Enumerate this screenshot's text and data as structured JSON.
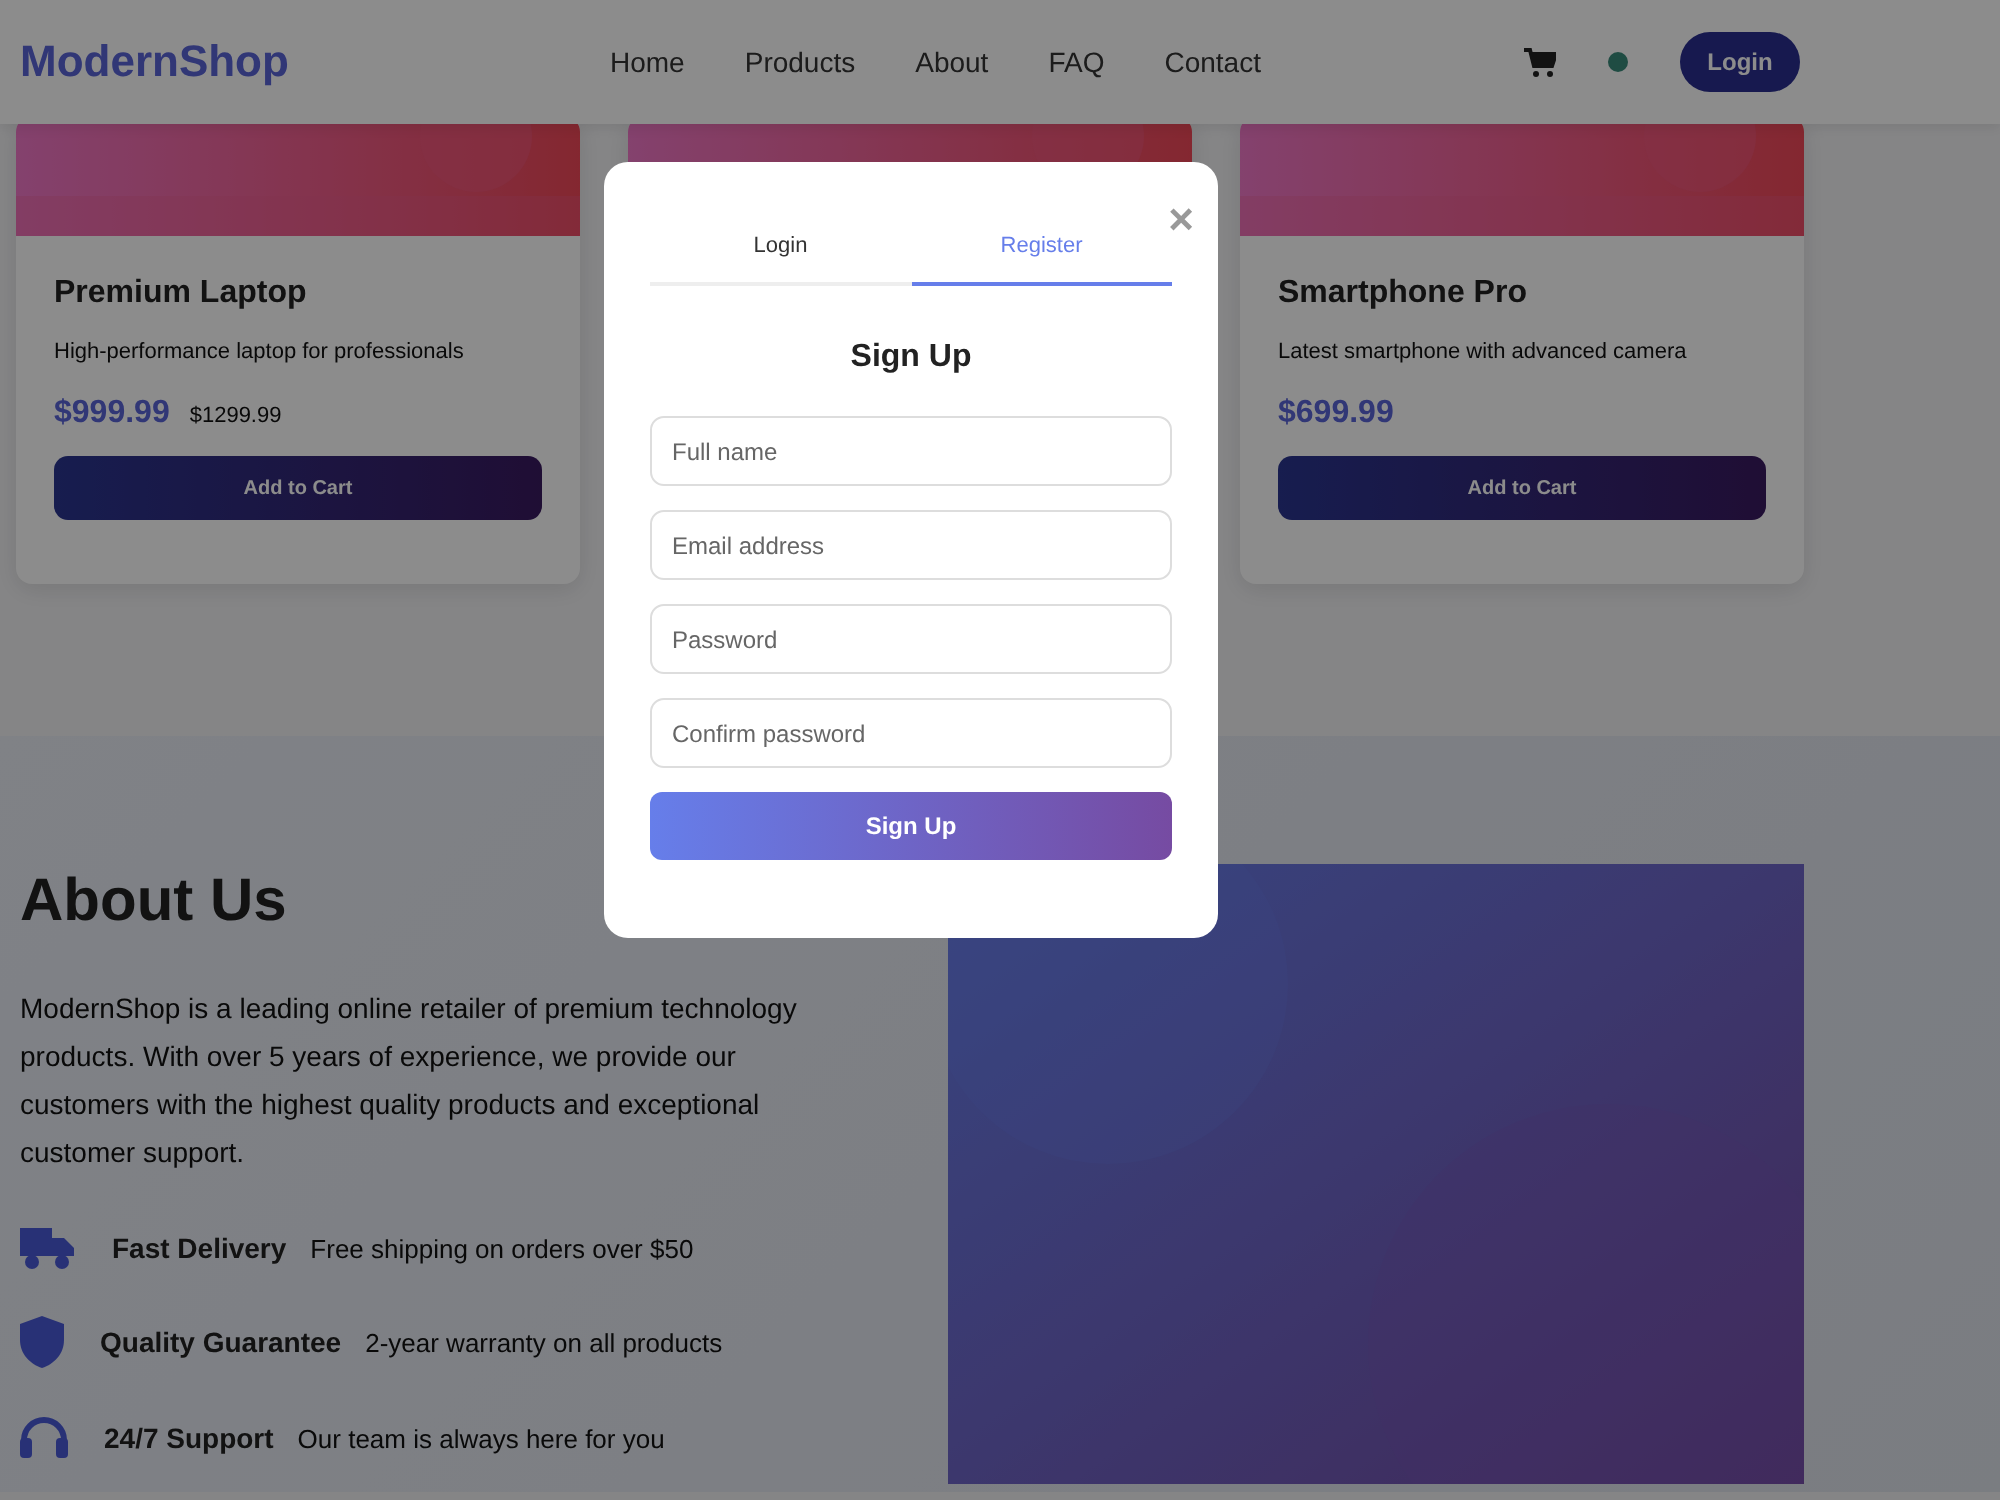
{
  "header": {
    "logo": "ModernShop",
    "nav": [
      "Home",
      "Products",
      "About",
      "FAQ",
      "Contact"
    ],
    "login_button": "Login"
  },
  "products": [
    {
      "kind": "full",
      "title": "Premium Laptop",
      "description": "High-performance laptop for professionals",
      "price": "$999.99",
      "old_price": "$1299.99",
      "button": "Add to Cart"
    },
    {
      "kind": "image_only"
    },
    {
      "kind": "full",
      "title": "Smartphone Pro",
      "description": "Latest smartphone with advanced camera",
      "price": "$699.99",
      "button": "Add to Cart"
    }
  ],
  "about": {
    "title": "About Us",
    "text": "ModernShop is a leading online retailer of premium technology products. With over 5 years of experience, we provide our customers with the highest quality products and exceptional customer support.",
    "features": [
      {
        "title": "Fast Delivery",
        "text": "Free shipping on orders over $50"
      },
      {
        "title": "Quality Guarantee",
        "text": "2-year warranty on all products"
      },
      {
        "title": "24/7 Support",
        "text": "Our team is always here for you"
      }
    ]
  },
  "modal": {
    "close": "×",
    "tabs": [
      {
        "label": "Login",
        "selected": false
      },
      {
        "label": "Register",
        "selected": true
      }
    ],
    "heading": "Sign Up",
    "fields": [
      {
        "placeholder": "Full name"
      },
      {
        "placeholder": "Email address"
      },
      {
        "placeholder": "Password"
      },
      {
        "placeholder": "Confirm password"
      }
    ],
    "submit": "Sign Up"
  }
}
